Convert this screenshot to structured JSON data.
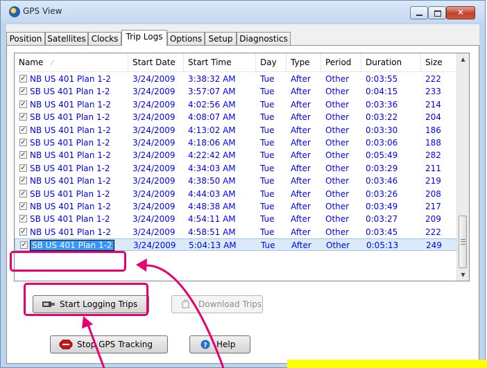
{
  "window": {
    "title": "GPS View"
  },
  "tabs": [
    {
      "label": "Position"
    },
    {
      "label": "Satellites"
    },
    {
      "label": "Clocks"
    },
    {
      "label": "Trip Logs",
      "active": true
    },
    {
      "label": "Options"
    },
    {
      "label": "Setup"
    },
    {
      "label": "Diagnostics"
    }
  ],
  "table": {
    "columns": [
      "Name",
      "Start Date",
      "Start Time",
      "Day",
      "Type",
      "Period",
      "Duration",
      "Size"
    ],
    "rows": [
      [
        "NB US 401 Plan 1-2",
        "3/24/2009",
        "3:38:32 AM",
        "Tue",
        "After",
        "Other",
        "0:03:55",
        "222"
      ],
      [
        "SB US 401 Plan 1-2",
        "3/24/2009",
        "3:57:07 AM",
        "Tue",
        "After",
        "Other",
        "0:04:15",
        "233"
      ],
      [
        "NB US 401 Plan 1-2",
        "3/24/2009",
        "4:02:56 AM",
        "Tue",
        "After",
        "Other",
        "0:03:36",
        "214"
      ],
      [
        "SB US 401 Plan 1-2",
        "3/24/2009",
        "4:08:07 AM",
        "Tue",
        "After",
        "Other",
        "0:03:22",
        "204"
      ],
      [
        "NB US 401 Plan 1-2",
        "3/24/2009",
        "4:13:02 AM",
        "Tue",
        "After",
        "Other",
        "0:03:30",
        "186"
      ],
      [
        "SB US 401 Plan 1-2",
        "3/24/2009",
        "4:18:06 AM",
        "Tue",
        "After",
        "Other",
        "0:03:06",
        "188"
      ],
      [
        "NB US 401 Plan 1-2",
        "3/24/2009",
        "4:22:42 AM",
        "Tue",
        "After",
        "Other",
        "0:05:49",
        "282"
      ],
      [
        "SB US 401 Plan 1-2",
        "3/24/2009",
        "4:34:03 AM",
        "Tue",
        "After",
        "Other",
        "0:03:29",
        "211"
      ],
      [
        "NB US 401 Plan 1-2",
        "3/24/2009",
        "4:38:50 AM",
        "Tue",
        "After",
        "Other",
        "0:03:46",
        "219"
      ],
      [
        "SB US 401 Plan 1-2",
        "3/24/2009",
        "4:44:03 AM",
        "Tue",
        "After",
        "Other",
        "0:03:26",
        "208"
      ],
      [
        "NB US 401 Plan 1-2",
        "3/24/2009",
        "4:48:38 AM",
        "Tue",
        "After",
        "Other",
        "0:03:49",
        "217"
      ],
      [
        "SB US 401 Plan 1-2",
        "3/24/2009",
        "4:54:11 AM",
        "Tue",
        "After",
        "Other",
        "0:03:27",
        "209"
      ],
      [
        "NB US 401 Plan 1-2",
        "3/24/2009",
        "4:58:51 AM",
        "Tue",
        "After",
        "Other",
        "0:03:45",
        "222"
      ],
      [
        "SB US 401 Plan 1-2",
        "3/24/2009",
        "5:04:13 AM",
        "Tue",
        "After",
        "Other",
        "0:05:13",
        "249"
      ]
    ],
    "selected_row_index": 13,
    "editing_value": "SB US 401 Plan 1-2"
  },
  "buttons": {
    "start_logging": "Start Logging Trips",
    "download_trips": "Download Trips",
    "stop_tracking": "Stop GPS Tracking",
    "help": "Help"
  },
  "colors": {
    "row_text": "#0000ff",
    "highlight": "#e8006e",
    "selection": "#3399ff",
    "note_bar": "#ffff00"
  },
  "icons": {
    "app": "gps-globe-icon",
    "start_logging": "tracking-device-icon",
    "download": "download-hand-icon",
    "stop": "stop-sign-icon",
    "help": "help-question-icon"
  }
}
